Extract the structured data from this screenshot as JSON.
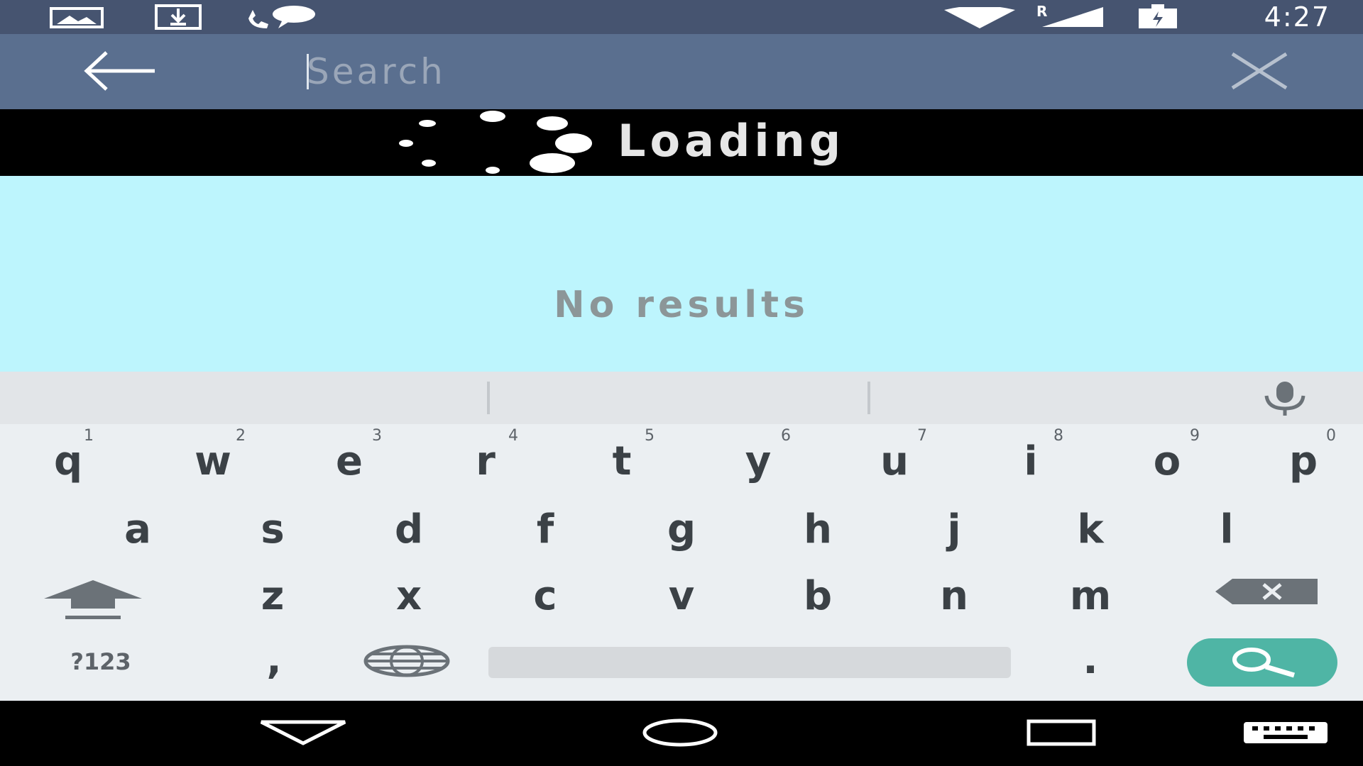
{
  "status_bar": {
    "time": "4:27",
    "icons": [
      "image-icon",
      "download-icon",
      "call-icon",
      "wifi-icon",
      "signal-icon",
      "battery-icon"
    ],
    "roaming_label": "R"
  },
  "toolbar": {
    "search_placeholder": "Search",
    "search_value": ""
  },
  "loading": {
    "label": "Loading"
  },
  "results": {
    "empty_message": "No results"
  },
  "keyboard": {
    "row1": [
      {
        "key": "q",
        "hint": "1"
      },
      {
        "key": "w",
        "hint": "2"
      },
      {
        "key": "e",
        "hint": "3"
      },
      {
        "key": "r",
        "hint": "4"
      },
      {
        "key": "t",
        "hint": "5"
      },
      {
        "key": "y",
        "hint": "6"
      },
      {
        "key": "u",
        "hint": "7"
      },
      {
        "key": "i",
        "hint": "8"
      },
      {
        "key": "o",
        "hint": "9"
      },
      {
        "key": "p",
        "hint": "0"
      }
    ],
    "row2": [
      "a",
      "s",
      "d",
      "f",
      "g",
      "h",
      "j",
      "k",
      "l"
    ],
    "row3": [
      "z",
      "x",
      "c",
      "v",
      "b",
      "n",
      "m"
    ],
    "symbols_label": "?123",
    "comma_label": ",",
    "period_label": "."
  },
  "colors": {
    "status_bar": "#465470",
    "toolbar": "#5a6f8f",
    "results_bg": "#bdf5fd",
    "search_key": "#4fb5a5"
  }
}
